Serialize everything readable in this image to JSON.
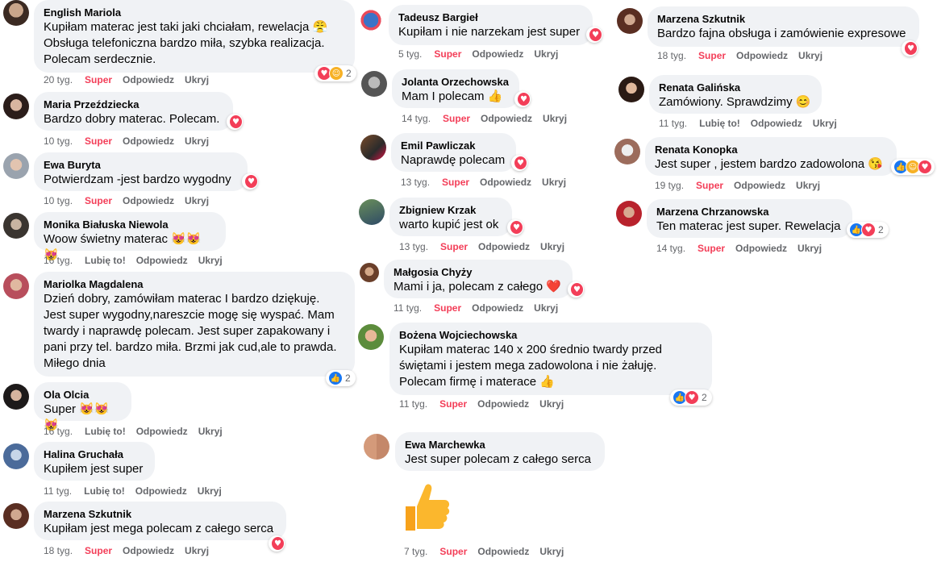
{
  "comments": [
    {
      "name": "English Mariola",
      "text": "Kupiłam materac jest taki jaki chciałam, rewelacja 😤\nObsługa telefoniczna bardzo miła, szybka realizacja.\nPolecam serdecznie.",
      "time": "20 tyg.",
      "reaction": "Super",
      "reply": "Odpowiedz",
      "hide": "Ukryj",
      "count": "2"
    },
    {
      "name": "Maria Przeździecka",
      "text": "Bardzo dobry materac. Polecam.",
      "time": "10 tyg.",
      "reaction": "Super",
      "reply": "Odpowiedz",
      "hide": "Ukryj"
    },
    {
      "name": "Ewa Buryta",
      "text": "Potwierdzam -jest bardzo wygodny",
      "time": "10 tyg.",
      "reaction": "Super",
      "reply": "Odpowiedz",
      "hide": "Ukryj"
    },
    {
      "name": "Monika Białuska Niewola",
      "text": "Woow świetny materac 😻😻😻",
      "time": "16 tyg.",
      "reaction": "Lubię to!",
      "reply": "Odpowiedz",
      "hide": "Ukryj"
    },
    {
      "name": "Mariolka Magdalena",
      "text": "Dzień dobry, zamówiłam materac I bardzo dziękuję.\nJest super wygodny,nareszcie mogę się wyspać. Mam\ntwardy i naprawdę polecam. Jest super zapakowany i\npani przy tel. bardzo miła. Brzmi jak cud,ale to prawda.\nMiłego dnia",
      "count": "2"
    },
    {
      "name": "Ola Olcia",
      "text": "Super 😻😻😻",
      "time": "16 tyg.",
      "reaction": "Lubię to!",
      "reply": "Odpowiedz",
      "hide": "Ukryj"
    },
    {
      "name": "Halina Gruchała",
      "text": "Kupiłem jest super",
      "time": "11 tyg.",
      "reaction": "Lubię to!",
      "reply": "Odpowiedz",
      "hide": "Ukryj"
    },
    {
      "name": "Marzena Szkutnik",
      "text": "Kupiłam jest mega polecam z całego serca",
      "time": "18 tyg.",
      "reaction": "Super",
      "reply": "Odpowiedz",
      "hide": "Ukryj"
    },
    {
      "name": "Tadeusz Bargieł",
      "text": "Kupiłam i nie narzekam jest super",
      "time": "5 tyg.",
      "reaction": "Super",
      "reply": "Odpowiedz",
      "hide": "Ukryj"
    },
    {
      "name": "Jolanta Orzechowska",
      "text": "Mam I polecam 👍",
      "time": "14 tyg.",
      "reaction": "Super",
      "reply": "Odpowiedz",
      "hide": "Ukryj"
    },
    {
      "name": "Emil Pawliczak",
      "text": "Naprawdę polecam",
      "time": "13 tyg.",
      "reaction": "Super",
      "reply": "Odpowiedz",
      "hide": "Ukryj"
    },
    {
      "name": "Zbigniew Krzak",
      "text": "warto kupić jest ok",
      "time": "13 tyg.",
      "reaction": "Super",
      "reply": "Odpowiedz",
      "hide": "Ukryj"
    },
    {
      "name": "Małgosia Chyży",
      "text": "Mami i ja, polecam z całego ❤️",
      "time": "11 tyg.",
      "reaction": "Super",
      "reply": "Odpowiedz",
      "hide": "Ukryj"
    },
    {
      "name": "Bożena Wojciechowska",
      "text": "Kupiłam materac 140 x 200 średnio twardy przed\nświętami i jestem mega zadowolona i nie żałuję.\nPolecam firmę i materace 👍",
      "time": "11 tyg.",
      "reaction": "Super",
      "reply": "Odpowiedz",
      "hide": "Ukryj",
      "count": "2"
    },
    {
      "name": "Ewa Marchewka",
      "text": "Jest super polecam z całego serca",
      "time": "7 tyg.",
      "reaction": "Super",
      "reply": "Odpowiedz",
      "hide": "Ukryj"
    },
    {
      "name": "Marzena Szkutnik",
      "text": "Bardzo fajna obsługa i zamówienie expresowe",
      "time": "18 tyg.",
      "reaction": "Super",
      "reply": "Odpowiedz",
      "hide": "Ukryj"
    },
    {
      "name": "Renata Galińska",
      "text": "Zamówiony. Sprawdzimy 😊",
      "time": "11 tyg.",
      "reaction": "Lubię to!",
      "reply": "Odpowiedz",
      "hide": "Ukryj"
    },
    {
      "name": "Renata Konopka",
      "text": "Jest super , jestem bardzo zadowolona 😘",
      "time": "19 tyg.",
      "reaction": "Super",
      "reply": "Odpowiedz",
      "hide": "Ukryj"
    },
    {
      "name": "Marzena Chrzanowska",
      "text": "Ten materac jest super. Rewelacja",
      "time": "14 tyg.",
      "reaction": "Super",
      "reply": "Odpowiedz",
      "hide": "Ukryj",
      "count": "2"
    }
  ],
  "icons": {
    "heart": "heart-icon",
    "like": "like-icon",
    "haha": "haha-icon",
    "thumb": "thumbs-up-sticker"
  },
  "colors": {
    "bubble": "#f0f2f5",
    "super": "#f33e58",
    "like": "#1877f2",
    "meta": "#65676b"
  }
}
